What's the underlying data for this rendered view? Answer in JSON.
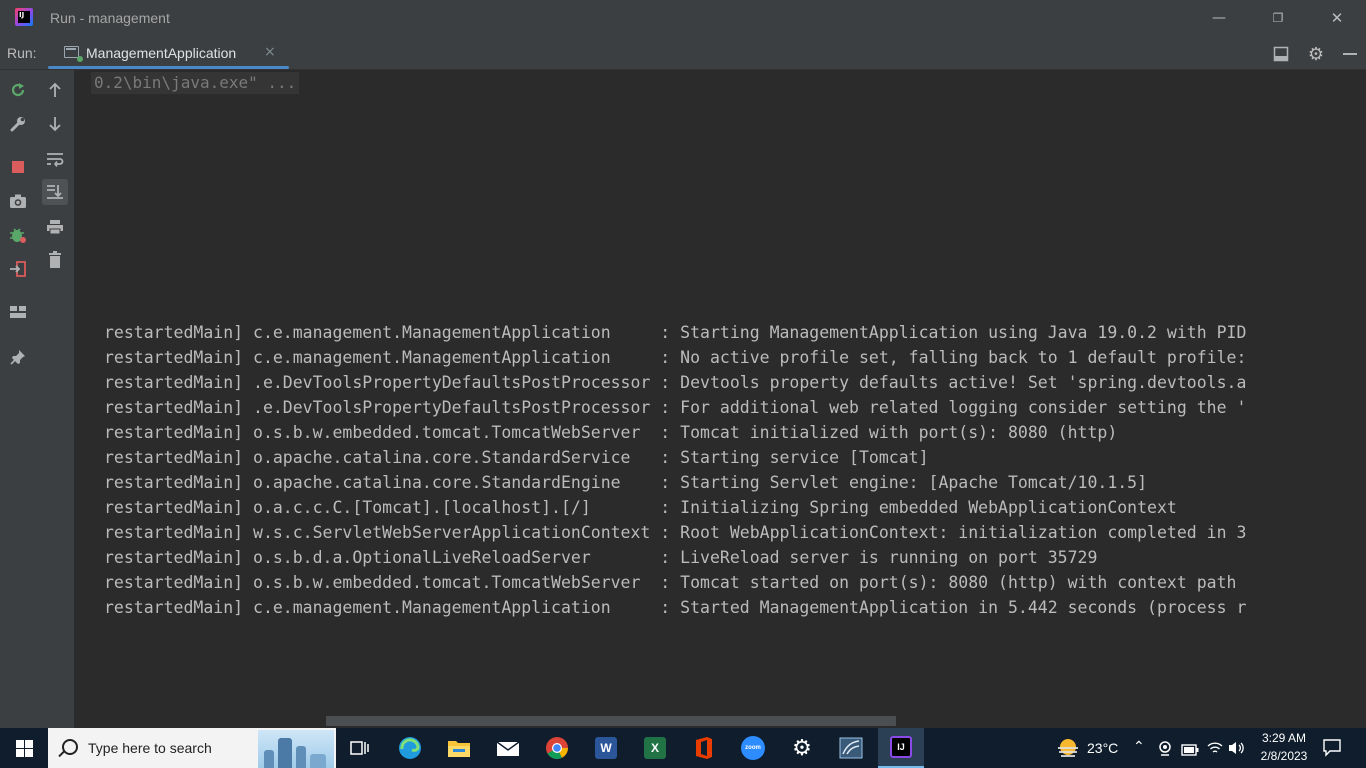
{
  "window": {
    "title": "Run - management",
    "app_logo_text": "IJ",
    "controls": {
      "minimize": "—",
      "restore": "❐",
      "close": "✕"
    }
  },
  "run_panel": {
    "label": "Run:",
    "tab": {
      "label": "ManagementApplication",
      "close": "×"
    }
  },
  "left_toolbar": {
    "icons": [
      "rerun-icon",
      "wrench-icon",
      "stop-icon",
      "camera-icon",
      "debug-bug-icon",
      "exit-icon",
      "layout-icon",
      "pin-icon"
    ]
  },
  "left_toolbar2": {
    "icons": [
      "arrow-up-icon",
      "arrow-down-icon",
      "soft-wrap-icon",
      "scroll-to-end-icon",
      "print-icon",
      "trash-icon"
    ]
  },
  "colors": {
    "accent": "#4a88c7",
    "console_bg": "#2b2b2b",
    "toolbar_bg": "#3c3f41",
    "stop_red": "#db5c5c",
    "rerun_green": "#59a869"
  },
  "console": {
    "command_line": "0.2\\bin\\java.exe\" ...",
    "log_lines": [
      "restartedMain] c.e.management.ManagementApplication     : Starting ManagementApplication using Java 19.0.2 with PID",
      "restartedMain] c.e.management.ManagementApplication     : No active profile set, falling back to 1 default profile:",
      "restartedMain] .e.DevToolsPropertyDefaultsPostProcessor : Devtools property defaults active! Set 'spring.devtools.a",
      "restartedMain] .e.DevToolsPropertyDefaultsPostProcessor : For additional web related logging consider setting the '",
      "restartedMain] o.s.b.w.embedded.tomcat.TomcatWebServer  : Tomcat initialized with port(s): 8080 (http)",
      "restartedMain] o.apache.catalina.core.StandardService   : Starting service [Tomcat]",
      "restartedMain] o.apache.catalina.core.StandardEngine    : Starting Servlet engine: [Apache Tomcat/10.1.5]",
      "restartedMain] o.a.c.c.C.[Tomcat].[localhost].[/]       : Initializing Spring embedded WebApplicationContext",
      "restartedMain] w.s.c.ServletWebServerApplicationContext : Root WebApplicationContext: initialization completed in 3",
      "restartedMain] o.s.b.d.a.OptionalLiveReloadServer       : LiveReload server is running on port 35729",
      "restartedMain] o.s.b.w.embedded.tomcat.TomcatWebServer  : Tomcat started on port(s): 8080 (http) with context path",
      "restartedMain] c.e.management.ManagementApplication     : Started ManagementApplication in 5.442 seconds (process r"
    ]
  },
  "taskbar": {
    "search_placeholder": "Type here to search",
    "apps": [
      "task-view-icon",
      "edge-icon",
      "file-explorer-icon",
      "mail-icon",
      "chrome-icon",
      "word-icon",
      "excel-icon",
      "office-icon",
      "zoom-icon",
      "settings-icon",
      "sql-icon",
      "intellij-icon"
    ],
    "word_letter": "W",
    "excel_letter": "X",
    "zoom_text": "zoom",
    "intellij_text": "IJ",
    "weather": "23°C",
    "time": "3:29 AM",
    "date": "2/8/2023"
  }
}
